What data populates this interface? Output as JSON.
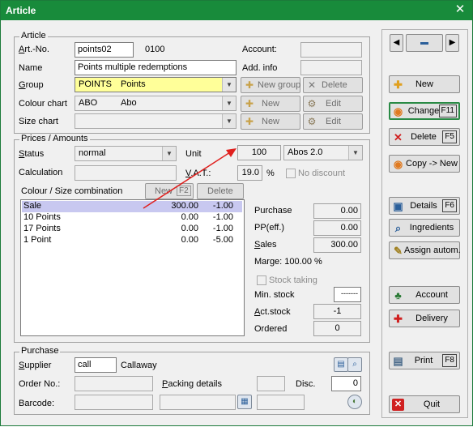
{
  "window": {
    "title": "Article",
    "close_glyph": "✕"
  },
  "article": {
    "legend": "Article",
    "art_no_label": "Art.-No.",
    "art_no": "points02",
    "art_code": "0100",
    "account_label": "Account:",
    "account": "",
    "name_label": "Name",
    "name": "Points multiple redemptions",
    "add_info_label": "Add. info",
    "add_info": "",
    "group_label": "Group",
    "group_code": "POINTS",
    "group_name": "Points",
    "new_group_label": "New group",
    "delete_label": "Delete",
    "colour_chart_label": "Colour chart",
    "colour_code": "ABO",
    "colour_name": "Abo",
    "new_label": "New",
    "edit_label": "Edit",
    "size_chart_label": "Size chart",
    "size_value": ""
  },
  "prices": {
    "legend": "Prices / Amounts",
    "status_label": "Status",
    "status": "normal",
    "unit_label": "Unit",
    "unit_qty": "100",
    "unit_name": "Abos 2.0",
    "calculation_label": "Calculation",
    "vat_label": "V.A.T.:",
    "vat": "19.0",
    "percent": "%",
    "no_discount_label": "No discount",
    "combination_label": "Colour / Size combination",
    "combo_new_label": "New",
    "combo_new_key": "F2",
    "combo_delete_label": "Delete",
    "rows": [
      {
        "name": "Sale",
        "amount": "300.00",
        "qty": "-1.00"
      },
      {
        "name": "10 Points",
        "amount": "0.00",
        "qty": "-1.00"
      },
      {
        "name": "17 Points",
        "amount": "0.00",
        "qty": "-1.00"
      },
      {
        "name": "1 Point",
        "amount": "0.00",
        "qty": "-5.00"
      }
    ],
    "purchase_label": "Purchase",
    "purchase": "0.00",
    "pp_label": "PP(eff.)",
    "pp": "0.00",
    "sales_label": "Sales",
    "sales": "300.00",
    "marge": "Marge: 100.00 %",
    "stock_taking_label": "Stock taking",
    "min_stock_label": "Min. stock",
    "min_stock": "-------",
    "act_stock_label": "Act.stock",
    "act_stock": "-1",
    "ordered_label": "Ordered",
    "ordered": "0"
  },
  "purchase": {
    "legend": "Purchase",
    "supplier_label": "Supplier",
    "supplier_code": "call",
    "supplier_name": "Callaway",
    "order_no_label": "Order No.:",
    "order_no": "",
    "packing_label": "Packing details",
    "packing": "",
    "disc_label": "Disc.",
    "disc": "0",
    "barcode_label": "Barcode:"
  },
  "sidebar": {
    "new": "New",
    "change": "Change",
    "change_key": "F11",
    "delete": "Delete",
    "delete_key": "F5",
    "copy_new": "Copy -> New",
    "details": "Details",
    "details_key": "F6",
    "ingredients": "Ingredients",
    "assign": "Assign autom.",
    "account": "Account",
    "delivery": "Delivery",
    "print": "Print",
    "print_key": "F8",
    "quit": "Quit"
  },
  "colors": {
    "title_bar": "#188b3b",
    "accent_arrow": "#e0201e",
    "group_highlight": "#ffff99",
    "selected_row": "#c8c8f0"
  }
}
